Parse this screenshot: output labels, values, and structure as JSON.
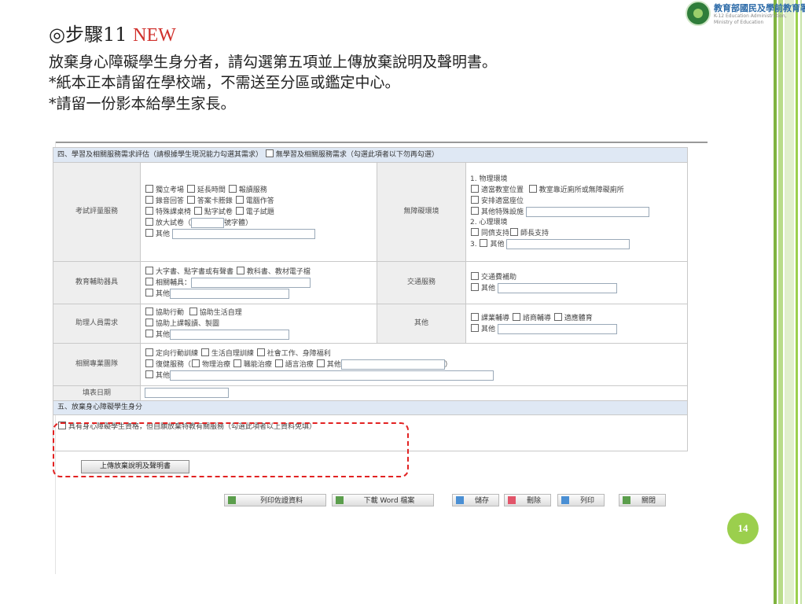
{
  "logo": {
    "name_cn": "教育部國民及學前教育署",
    "name_en_line1": "K-12 Education Administration,",
    "name_en_line2": "Ministry of Education"
  },
  "slide": {
    "step_title": "◎步驟11",
    "step_badge": "NEW",
    "lines": [
      "放棄身心障礙學生身分者，請勾選第五項並上傳放棄說明及聲明書。",
      "*紙本正本請留在學校端，不需送至分區或鑑定中心。",
      "*請留一份影本給學生家長。"
    ],
    "page_number": "14",
    "colors": {
      "accent_red": "#d0312d",
      "accent_green": "#9bcf4d",
      "bar_green": "#7fb33f",
      "section_blue": "#dfe8f4"
    }
  },
  "form": {
    "section4_title": "四、學習及相關服務需求評估（請根據學生現況能力勾選其需求）",
    "section4_none": "無學習及相關服務需求（勾選此項者以下勿再勾選）",
    "exam": {
      "label": "考試評量服務",
      "row1": [
        "獨立考場",
        "延長時間",
        "報讀服務"
      ],
      "row2": [
        "錄音回答",
        "答案卡謄錄",
        "電腦作答"
      ],
      "row3": [
        "特殊課桌椅",
        "點字試卷",
        "電子試題"
      ],
      "enlarge_prefix": "放大試卷（",
      "enlarge_suffix": "號字體）",
      "other": "其他"
    },
    "barrier": {
      "label": "無障礙環境",
      "phys_title": "1. 物理環境",
      "phys1": "適當教室位置",
      "phys2": "教室靠近廁所或無障礙廁所",
      "phys3": "安排適當座位",
      "phys4": "其他特殊設施",
      "psy_title": "2. 心理環境",
      "psy1": "同儕支持",
      "psy2": "師長支持",
      "item3": "3.",
      "other": "其他"
    },
    "aids": {
      "label": "教育輔助器具",
      "opt1": "大字書、點字書或有聲書",
      "opt2": "教科書、教材電子檔",
      "opt3": "相關輔具：",
      "other": "其他"
    },
    "transport": {
      "label": "交通服務",
      "opt1": "交通費補助",
      "other": "其他"
    },
    "assistant": {
      "label": "助理人員需求",
      "opt1": "協助行動",
      "opt2": "協助生活自理",
      "opt3": "協助上課報讀、製圖",
      "other": "其他"
    },
    "others": {
      "label": "其他",
      "opt1": "課業輔導",
      "opt2": "諮商輔導",
      "opt3": "適應體育",
      "other": "其他"
    },
    "team": {
      "label": "相關專業團隊",
      "opt1": "定向行動訓練",
      "opt2": "生活自理訓練",
      "opt3": "社會工作、身障福利",
      "rehab_prefix": "復健服務（",
      "rehab1": "物理治療",
      "rehab2": "職能治療",
      "rehab3": "語言治療",
      "rehab_other": "其他",
      "rehab_suffix": "）",
      "other": "其他"
    },
    "date_label": "填表日期",
    "section5_title": "五、放棄身心障礙學生身分",
    "section5_option": "具有身心障礙學生資格，但自願放棄特教有關服務（勾選此項者以上資料免填）",
    "upload_button": "上傳放棄說明及聲明書",
    "buttons": {
      "print_doc": "列印佐證資料",
      "download_word": "下載 Word 檔案",
      "save": "儲存",
      "delete": "刪除",
      "print": "列印",
      "close": "關閉"
    }
  }
}
